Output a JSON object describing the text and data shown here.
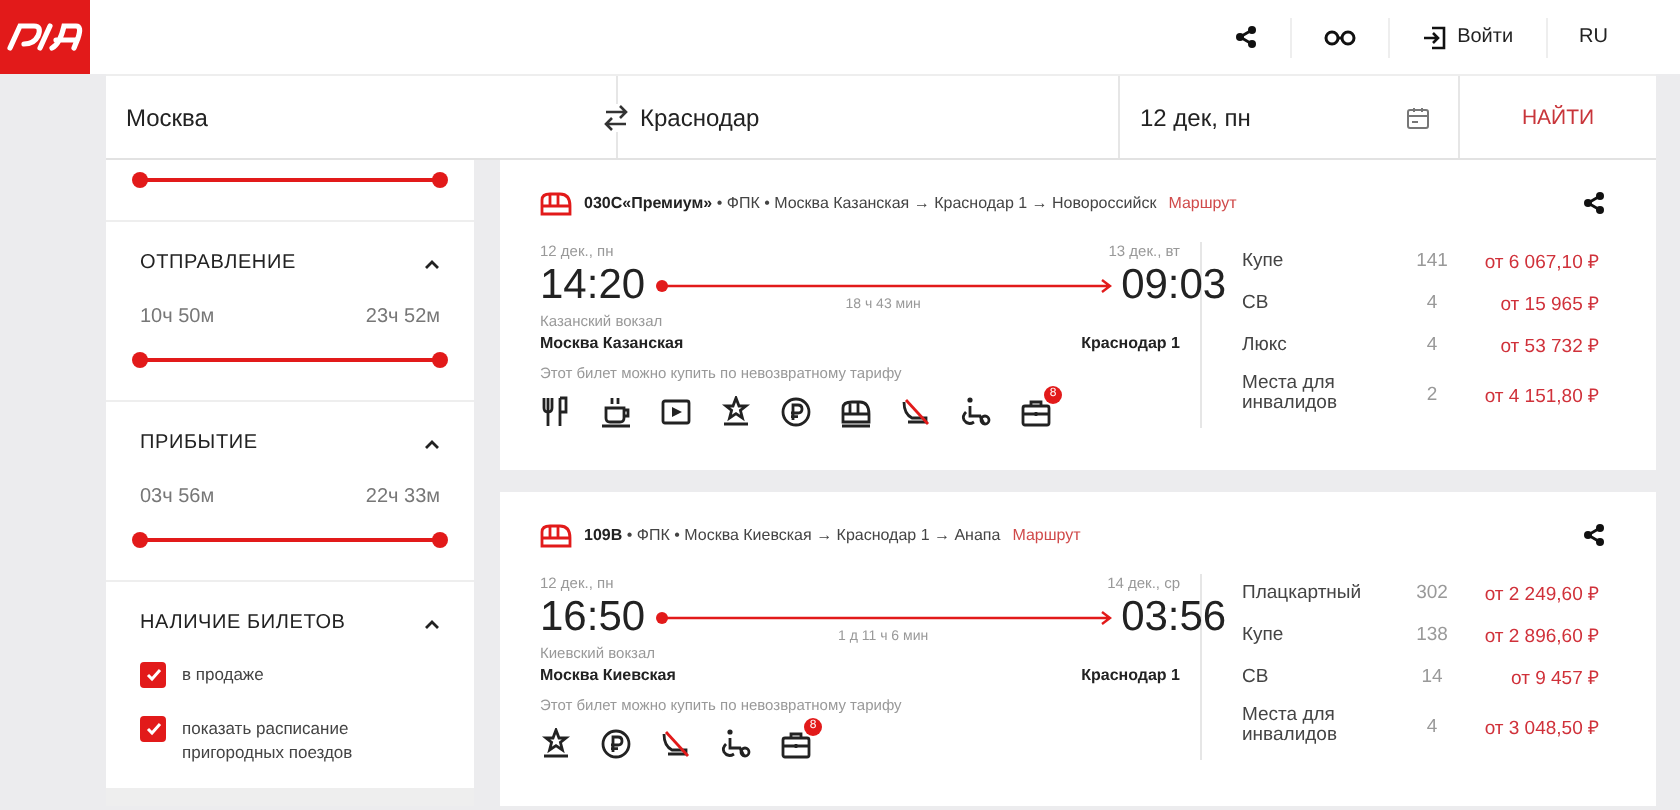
{
  "header": {
    "actions": [
      {
        "kind": "share"
      },
      {
        "kind": "glasses"
      },
      {
        "kind": "login",
        "label": "Войти"
      },
      {
        "kind": "lang",
        "label": "RU"
      }
    ]
  },
  "search": {
    "from": "Москва",
    "to": "Краснодар",
    "date": "12 дек, пн",
    "button": "НАЙТИ"
  },
  "filters": [
    {
      "kind": "range",
      "level": 1
    },
    {
      "kind": "range",
      "title": "ОТПРАВЛЕНИЕ",
      "expanded": true,
      "min": "10ч 50м",
      "max": "23ч 52м",
      "level": 1
    },
    {
      "kind": "range",
      "title": "ПРИБЫТИЕ",
      "expanded": true,
      "min": "03ч 56м",
      "max": "22ч 33м",
      "level": 1
    },
    {
      "kind": "checks",
      "title": "НАЛИЧИЕ БИЛЕТОВ",
      "expanded": true,
      "options": [
        {
          "label": "в продаже",
          "checked": true
        },
        {
          "label": "показать расписание пригородных поездов",
          "checked": true
        }
      ]
    }
  ],
  "trains": [
    {
      "title": "**030С«Премиум»** • ФПК • Москва Казанская → Краснодар 1 → Новороссийск",
      "route_link": "Маршрут",
      "depart": {
        "date": "12 дек., пн",
        "time": "14:20",
        "area": "Казанский вокзал",
        "station": "Москва Казанская"
      },
      "duration": "18 ч 43 мин",
      "arrive": {
        "date": "13 дек., вт",
        "time": "09:03",
        "station": "Краснодар 1"
      },
      "note": "Этот билет можно купить по невозвратному тарифу",
      "amenities": [
        {
          "kind": "dining"
        },
        {
          "kind": "coffee"
        },
        {
          "kind": "video"
        },
        {
          "kind": "star"
        },
        {
          "kind": "coin"
        },
        {
          "kind": "train"
        },
        {
          "kind": "nopet"
        },
        {
          "kind": "wheelchair"
        },
        {
          "kind": "luggage",
          "badge": "8"
        }
      ],
      "classes": [
        {
          "name": "Купе",
          "seats": "141",
          "price": "от 6 067,10 ₽"
        },
        {
          "name": "СВ",
          "seats": "4",
          "price": "от 15 965 ₽"
        },
        {
          "name": "Люкс",
          "seats": "4",
          "price": "от 53 732 ₽"
        },
        {
          "name": "Места для инвалидов",
          "seats": "2",
          "price": "от 4 151,80 ₽"
        }
      ]
    },
    {
      "title": "**109В** • ФПК • Москва Киевская → Краснодар 1 → Анапа",
      "route_link": "Маршрут",
      "depart": {
        "date": "12 дек., пн",
        "time": "16:50",
        "area": "Киевский вокзал",
        "station": "Москва Киевская"
      },
      "duration": "1 д 11 ч 6 мин",
      "arrive": {
        "date": "14 дек., ср",
        "time": "03:56",
        "station": "Краснодар 1"
      },
      "note": "Этот билет можно купить по невозвратному тарифу",
      "amenities": [
        {
          "kind": "star"
        },
        {
          "kind": "coin"
        },
        {
          "kind": "nopet"
        },
        {
          "kind": "wheelchair"
        },
        {
          "kind": "luggage",
          "badge": "8"
        }
      ],
      "classes": [
        {
          "name": "Плацкартный",
          "seats": "302",
          "price": "от 2 249,60 ₽"
        },
        {
          "name": "Купе",
          "seats": "138",
          "price": "от 2 896,60 ₽"
        },
        {
          "name": "СВ",
          "seats": "14",
          "price": "от 9 457 ₽"
        },
        {
          "name": "Места для инвалидов",
          "seats": "4",
          "price": "от 3 048,50 ₽"
        }
      ]
    }
  ]
}
